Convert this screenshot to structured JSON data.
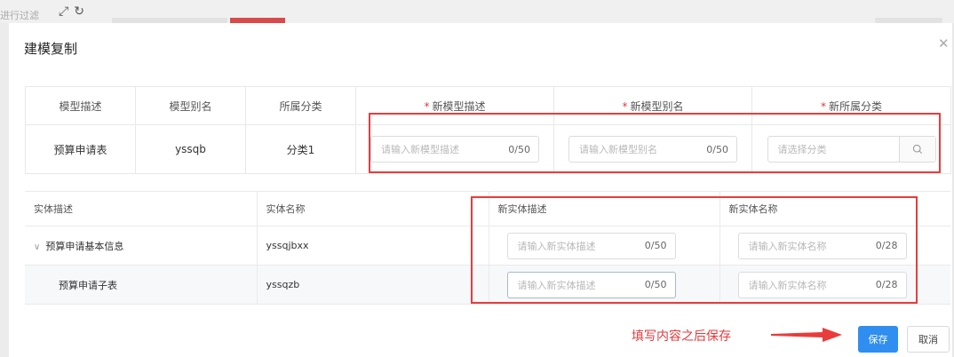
{
  "background": {
    "filter_text": "进行过滤",
    "icons": [
      "expand-icon",
      "refresh-icon"
    ]
  },
  "modal": {
    "title": "建模复制",
    "close_icon": "close-icon"
  },
  "model_table": {
    "headers": [
      "模型描述",
      "模型别名",
      "所属分类",
      "新模型描述",
      "新模型别名",
      "新所属分类"
    ],
    "required_mark": "*",
    "row": {
      "desc": "预算申请表",
      "alias": "yssqb",
      "category": "分类1"
    },
    "inputs": {
      "desc_placeholder": "请输入新模型描述",
      "desc_count": "0/50",
      "alias_placeholder": "请输入新模型别名",
      "alias_count": "0/50",
      "category_placeholder": "请选择分类",
      "category_icon": "search-icon"
    }
  },
  "entity_table": {
    "headers": [
      "实体描述",
      "实体名称",
      "新实体描述",
      "新实体名称"
    ],
    "rows": [
      {
        "desc": "预算申请基本信息",
        "name": "yssqjbxx",
        "expand_icon": "chevron-down-icon",
        "desc_placeholder": "请输入新实体描述",
        "desc_count": "0/50",
        "name_placeholder": "请输入新实体名称",
        "name_count": "0/28"
      },
      {
        "desc": "预算申请子表",
        "name": "yssqzb",
        "desc_placeholder": "请输入新实体描述",
        "desc_count": "0/50",
        "name_placeholder": "请输入新实体名称",
        "name_count": "0/28"
      }
    ]
  },
  "annotation": {
    "text": "填写内容之后保存",
    "color": "#e4393c"
  },
  "footer": {
    "save_label": "保存",
    "cancel_label": "取消",
    "accent": "#2f8ef0"
  }
}
